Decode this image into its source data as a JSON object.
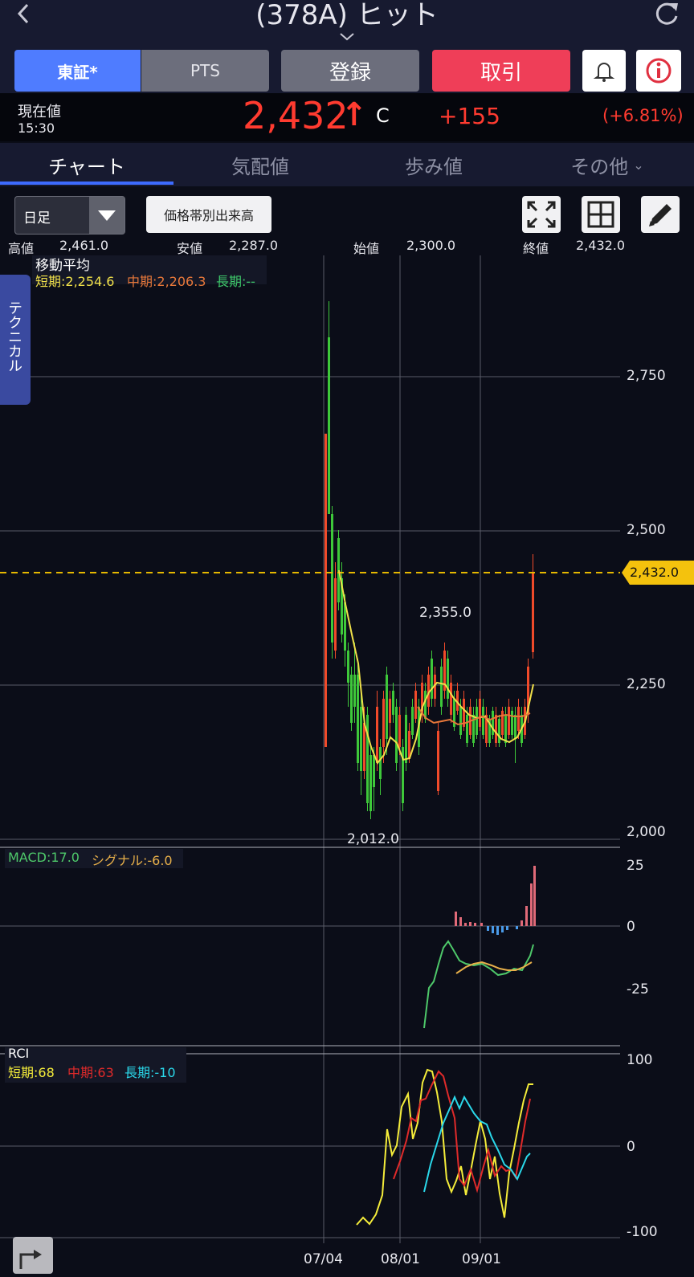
{
  "header": {
    "title": "(378A) ヒット",
    "back_icon": "chevron-left-icon",
    "refresh_icon": "refresh-icon",
    "expand_icon": "chevron-down-icon"
  },
  "market_buttons": {
    "tse": "東証*",
    "pts": "PTS",
    "register": "登録",
    "trade": "取引",
    "alert_icon": "bell-icon",
    "info_icon": "info-icon"
  },
  "quote": {
    "label": "現在値",
    "time": "15:30",
    "price": "2,432",
    "arrow": "↑",
    "flag": "C",
    "change": "+155",
    "change_pct": "(+6.81%)",
    "up_color": "#ff3b30"
  },
  "tabs": [
    {
      "label": "チャート"
    },
    {
      "label": "気配値"
    },
    {
      "label": "歩み値"
    },
    {
      "label": "その他"
    }
  ],
  "toolbar": {
    "period": "日足",
    "volume_by_price": "価格帯別出来高",
    "fullscreen_icon": "expand-icon",
    "grid_icon": "grid-icon",
    "draw_icon": "pencil-icon"
  },
  "ohlc": {
    "high_label": "高値",
    "high": "2,461.0",
    "low_label": "安値",
    "low": "2,287.0",
    "open_label": "始値",
    "open": "2,300.0",
    "close_label": "終値",
    "close": "2,432.0"
  },
  "ma": {
    "title": "移動平均",
    "short": "短期:2,254.6",
    "mid": "中期:2,206.3",
    "long": "長期:--"
  },
  "side_tab": "テクニカル",
  "price_axis": {
    "ticks": [
      "2,750",
      "2,500",
      "2,250",
      "2,000"
    ],
    "current": "2,432.0",
    "high_note": "2,355.0",
    "low_note": "2,012.0"
  },
  "macd": {
    "legend": "MACD:17.0",
    "signal": "シグナル:-6.0",
    "ticks": [
      "25",
      "0",
      "-25"
    ]
  },
  "rci": {
    "title": "RCI",
    "short": "短期:68",
    "mid": "中期:63",
    "long": "長期:-10",
    "ticks": [
      "100",
      "0",
      "-100"
    ]
  },
  "dates": [
    "07/04",
    "08/01",
    "09/01"
  ],
  "chart_data": {
    "type": "candlestick",
    "title": "",
    "x": [
      "07/04",
      "08/01",
      "09/01"
    ],
    "price_ylim": [
      2000,
      2750
    ],
    "last_close": 2432,
    "period_high_label": 2355,
    "period_low_label": 2012,
    "ma_short_last": 2254.6,
    "ma_mid_last": 2206.3,
    "macd_last": 17.0,
    "signal_last": -6.0,
    "rci_short_last": 68,
    "rci_mid_last": 63,
    "rci_long_last": -10
  }
}
